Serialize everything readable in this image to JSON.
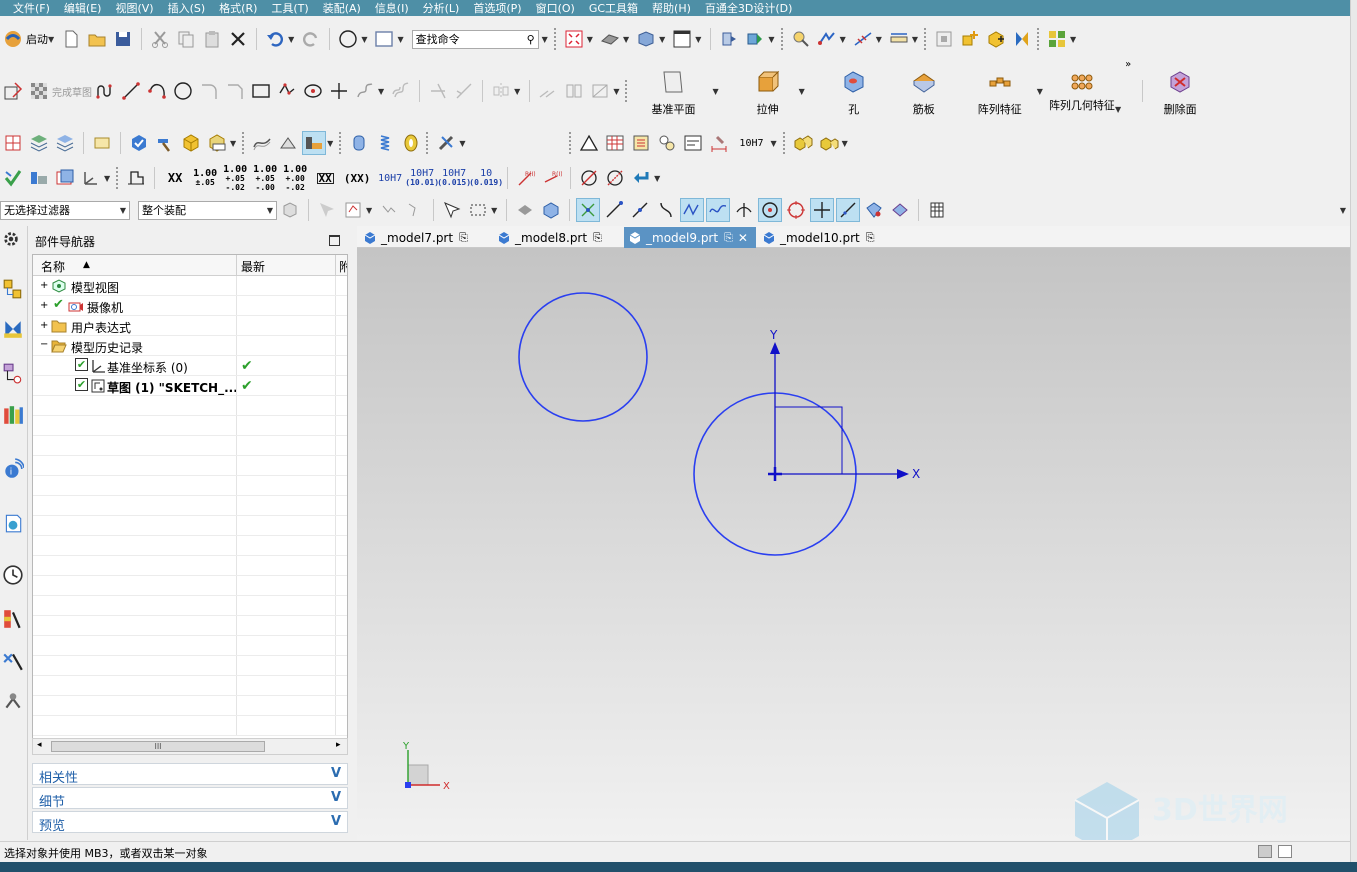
{
  "menu": [
    "文件(F)",
    "编辑(E)",
    "视图(V)",
    "插入(S)",
    "格式(R)",
    "工具(T)",
    "装配(A)",
    "信息(I)",
    "分析(L)",
    "首选项(P)",
    "窗口(O)",
    "GC工具箱",
    "帮助(H)",
    "百通全3D设计(D)"
  ],
  "toolbar1": {
    "start_label": "启动",
    "search_placeholder": "查找命令"
  },
  "toolbar2": {
    "finish_sketch": "完成草图",
    "big_buttons": [
      {
        "label": "基准平面",
        "icon": "datum-plane-icon"
      },
      {
        "label": "拉伸",
        "icon": "extrude-icon"
      },
      {
        "label": "孔",
        "icon": "hole-icon"
      },
      {
        "label": "筋板",
        "icon": "rib-icon"
      },
      {
        "label": "阵列特征",
        "icon": "pattern-feature-icon"
      },
      {
        "label": "阵列几何特征",
        "icon": "pattern-geometry-icon"
      },
      {
        "label": "删除面",
        "icon": "delete-face-icon"
      }
    ]
  },
  "toolbar4": {
    "dims": [
      {
        "top": "1.00",
        "bottom": "±.05"
      },
      {
        "top": "1.00",
        "bottom": "+.05 -.02"
      },
      {
        "top": "1.00",
        "bottom": "+.05 -.00"
      },
      {
        "top": "1.00",
        "bottom": "+.00 -.02"
      }
    ],
    "xx": "XX",
    "xx_box": "XX",
    "xx_paren": "(XX)",
    "fit1": "10H7",
    "fit2_top": "10H7",
    "fit2_bottom": "(10.01)",
    "fit3_top": "10H7",
    "fit3_bottom": "(0.015)",
    "fit4_top": "10",
    "fit4_bottom": "(0.019)",
    "r_label": "R(I)"
  },
  "toolbar3": {
    "fit_label": "10H7"
  },
  "filters": {
    "selection_filter": "无选择过滤器",
    "scope": "整个装配"
  },
  "navigator": {
    "title": "部件导航器",
    "col_name": "名称",
    "col_latest": "最新",
    "col_more": "附",
    "tree": [
      {
        "label": "模型视图",
        "icon": "model-view-icon",
        "expander": "+",
        "latest": ""
      },
      {
        "label": "摄像机",
        "icon": "camera-icon",
        "expander": "+",
        "latest": ""
      },
      {
        "label": "用户表达式",
        "icon": "folder-icon",
        "expander": "+",
        "latest": ""
      },
      {
        "label": "模型历史记录",
        "icon": "folder-open-icon",
        "expander": "−",
        "latest": ""
      },
      {
        "label": "基准坐标系 (0)",
        "icon": "datum-csys-icon",
        "expander": "",
        "latest": "✔"
      },
      {
        "label": "草图 (1) \"SKETCH_...",
        "icon": "sketch-icon",
        "expander": "",
        "latest": "✔"
      }
    ],
    "panels": [
      "相关性",
      "细节",
      "预览"
    ],
    "scroll_grip": "III"
  },
  "tabs": [
    {
      "label": "_model7.prt",
      "selected": false
    },
    {
      "label": "_model8.prt",
      "selected": false
    },
    {
      "label": "_model9.prt",
      "selected": true
    },
    {
      "label": "_model10.prt",
      "selected": false
    }
  ],
  "viewport": {
    "axis_x": "X",
    "axis_y": "Y",
    "triad_x": "X",
    "triad_y": "Y"
  },
  "status_text": "选择对象并使用 MB3，或者双击某一对象",
  "watermark": "3D世界网",
  "colors": {
    "menubar": "#4e8fa6",
    "sketch_curve": "#2a3ff0",
    "axis": "#1010c8",
    "tab_selected": "#5b93c4",
    "check": "#2ca02c"
  }
}
